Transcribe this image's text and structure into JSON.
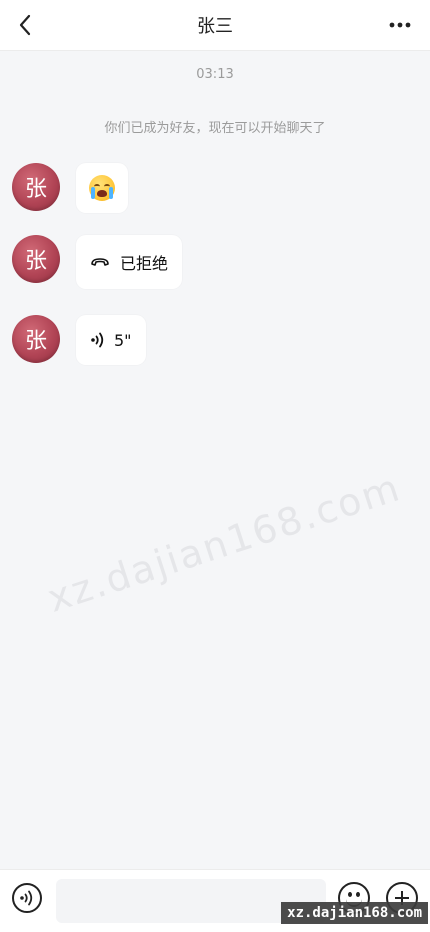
{
  "header": {
    "title": "张三"
  },
  "chat": {
    "timestamp": "03:13",
    "system_message": "你们已成为好友，现在可以开始聊天了",
    "messages": [
      {
        "avatar_text": "张",
        "type": "emoji",
        "icon": "crying-face-emoji"
      },
      {
        "avatar_text": "张",
        "type": "call",
        "icon": "phone-hangup-icon",
        "text": "已拒绝"
      },
      {
        "avatar_text": "张",
        "type": "voice",
        "icon": "voice-wave-icon",
        "text": "5\""
      }
    ]
  },
  "watermark": {
    "text": "xz.dajian168.com"
  },
  "bottom_bar": {
    "input_value": "",
    "input_placeholder": ""
  },
  "corner_badge": {
    "text": "xz.dajian168.com"
  },
  "colors": {
    "avatar": "#b14455",
    "background": "#f5f6f8",
    "bubble": "#ffffff"
  }
}
